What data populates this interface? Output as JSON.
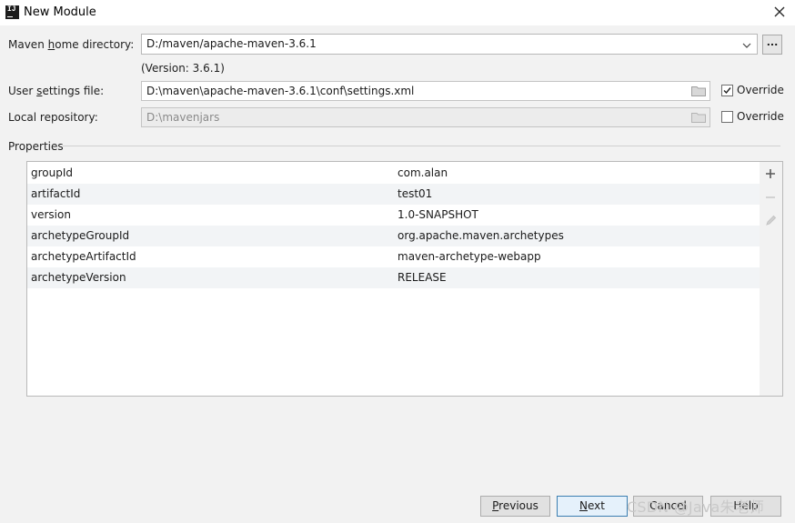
{
  "window": {
    "title": "New Module",
    "icon": "intellij-icon",
    "icon_text": "IJ"
  },
  "maven_home": {
    "label_before": "Maven ",
    "label_underlined": "h",
    "label_after": "ome directory:",
    "value": "D:/maven/apache-maven-3.6.1",
    "version": "(Version: 3.6.1)",
    "browse_label": "..."
  },
  "user_settings": {
    "label_before": "User ",
    "label_underlined": "s",
    "label_after": "ettings file:",
    "value": "D:\\maven\\apache-maven-3.6.1\\conf\\settings.xml",
    "override_label": "Override",
    "override_checked": true
  },
  "local_repo": {
    "label": "Local repository:",
    "value": "D:\\mavenjars",
    "override_label": "Override",
    "override_checked": false
  },
  "properties": {
    "label": "Properties",
    "rows": [
      {
        "key": "groupId",
        "value": "com.alan"
      },
      {
        "key": "artifactId",
        "value": "test01"
      },
      {
        "key": "version",
        "value": "1.0-SNAPSHOT"
      },
      {
        "key": "archetypeGroupId",
        "value": "org.apache.maven.archetypes"
      },
      {
        "key": "archetypeArtifactId",
        "value": "maven-archetype-webapp"
      },
      {
        "key": "archetypeVersion",
        "value": "RELEASE"
      }
    ]
  },
  "buttons": {
    "previous": {
      "mnemonic": "P",
      "rest": "revious"
    },
    "next": {
      "mnemonic": "N",
      "rest": "ext"
    },
    "cancel": "Cancel",
    "help": "Help"
  },
  "watermark": "CSDN @Java朱老师",
  "colors": {
    "background": "#f2f2f2",
    "accent": "#3c7fb1",
    "add_icon": "#5a5a5a",
    "disabled_icon": "#c4c4c4"
  }
}
